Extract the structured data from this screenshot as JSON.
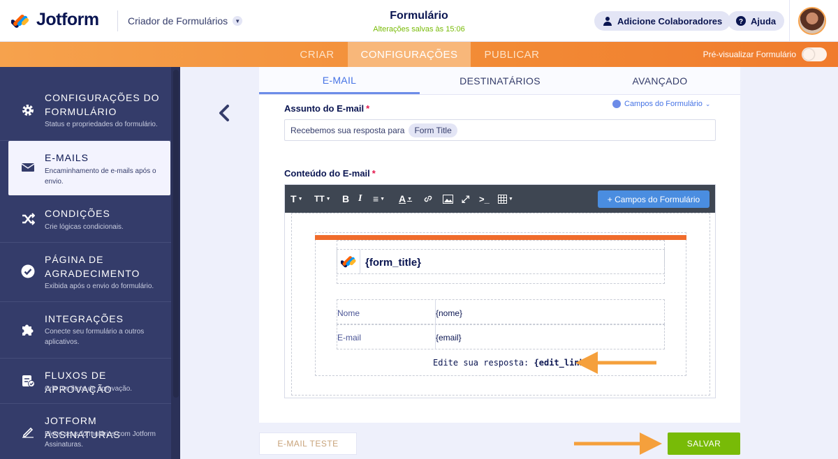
{
  "header": {
    "brand": "Jotform",
    "builder_label": "Criador de Formulários",
    "form_title": "Formulário",
    "save_status": "Alterações salvas às 15:06",
    "add_collaborators": "Adicione Colaboradores",
    "help": "Ajuda"
  },
  "nav": {
    "tabs": [
      {
        "label": "CRIAR"
      },
      {
        "label": "CONFIGURAÇÕES"
      },
      {
        "label": "PUBLICAR"
      }
    ],
    "preview_label": "Pré-visualizar Formulário"
  },
  "sidebar": {
    "items": [
      {
        "title": "CONFIGURAÇÕES DO FORMULÁRIO",
        "desc": "Status e propriedades do formulário.",
        "icon": "gear-icon"
      },
      {
        "title": "E-MAILS",
        "desc": "Encaminhamento de e-mails após o envio.",
        "icon": "envelope-icon"
      },
      {
        "title": "CONDIÇÕES",
        "desc": "Crie lógicas condicionais.",
        "icon": "shuffle-icon"
      },
      {
        "title": "PÁGINA DE AGRADECIMENTO",
        "desc": "Exibida após o envio do formulário.",
        "icon": "check-circle-icon"
      },
      {
        "title": "INTEGRAÇÕES",
        "desc": "Conecte seu formulário a outros aplicativos.",
        "icon": "puzzle-icon"
      },
      {
        "title": "FLUXOS DE APROVAÇÃO",
        "desc": "Crie um fluxo de aprovação.",
        "icon": "approval-icon"
      },
      {
        "title": "JOTFORM ASSINATURAS",
        "desc": "Eleve seus formulários com Jotform Assinaturas.",
        "icon": "signature-icon"
      }
    ]
  },
  "email_tabs": [
    {
      "label": "E-MAIL"
    },
    {
      "label": "DESTINATÁRIOS"
    },
    {
      "label": "AVANÇADO"
    }
  ],
  "subject": {
    "label": "Assunto do E-mail",
    "required_mark": "*",
    "fields_link": "Campos do Formulário",
    "text": "Recebemos sua resposta para",
    "tag": "Form Title"
  },
  "content": {
    "label": "Conteúdo do E-mail",
    "required_mark": "*",
    "add_fields_button": "+ Campos do Formulário",
    "form_title_placeholder": "{form_title}",
    "rows": [
      {
        "label": "Nome",
        "value": "{nome}"
      },
      {
        "label": "E-mail",
        "value": "{email}"
      }
    ],
    "edit_text": "Edite sua resposta:",
    "edit_link": "{edit_link}"
  },
  "footer": {
    "test_email": "E-MAIL TESTE",
    "save": "SALVAR"
  },
  "colors": {
    "accent_orange": "#f28a35",
    "sidebar_bg": "#343c6a",
    "save_green": "#78bb07",
    "link_blue": "#4573e5",
    "annotation_arrow": "#f5a03c"
  }
}
